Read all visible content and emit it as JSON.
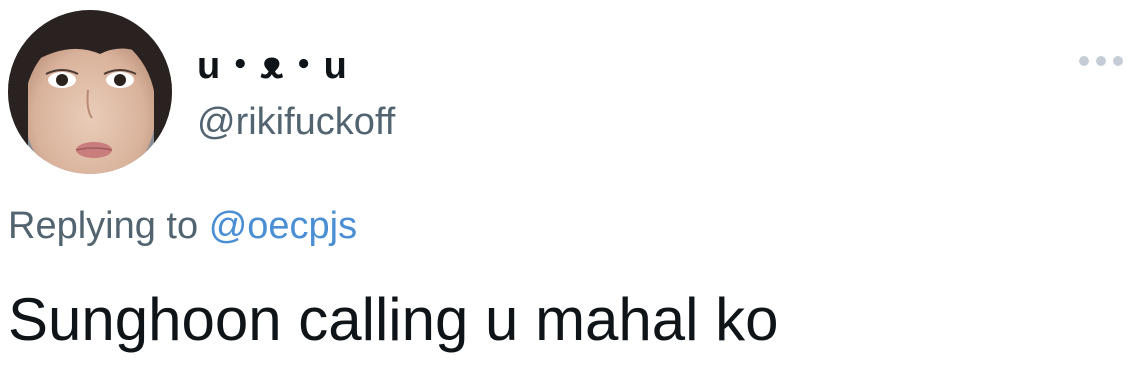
{
  "tweet": {
    "author": {
      "display_name": "u・ᴥ・u",
      "handle": "@rikifuckoff"
    },
    "more_icon": "more-horizontal-icon",
    "reply": {
      "prefix": "Replying to",
      "mention": "@oecpjs"
    },
    "text": "Sunghoon calling u mahal ko"
  },
  "colors": {
    "secondary_text": "#536471",
    "mention": "#4a8fd4",
    "primary_text": "#0f1419"
  }
}
